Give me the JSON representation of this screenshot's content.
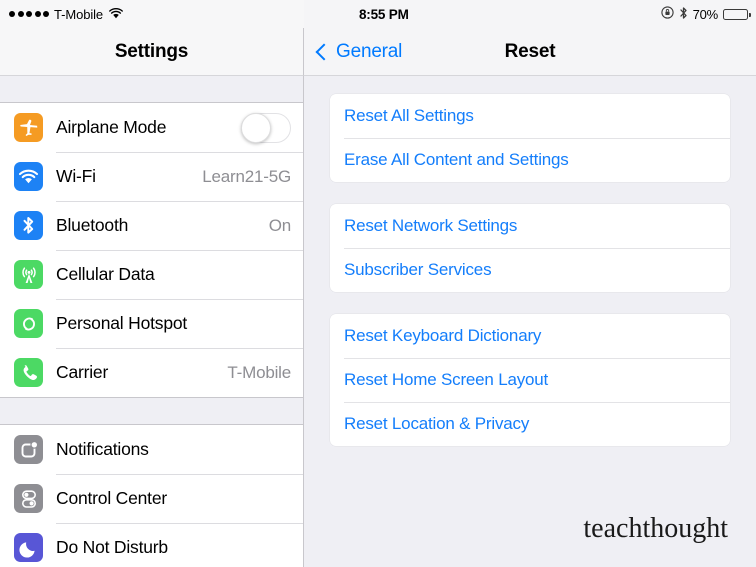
{
  "status_bar": {
    "signal_dots": 5,
    "carrier": "T-Mobile",
    "wifi_icon": "wifi-icon",
    "time": "8:55 PM",
    "rotation_lock_icon": "rotation-lock-icon",
    "bluetooth_icon": "bluetooth-icon",
    "battery_percent": "70%",
    "battery_level": 70
  },
  "sidebar": {
    "title": "Settings",
    "groups": [
      {
        "items": [
          {
            "label": "Airplane Mode",
            "icon": "airplane-icon",
            "icon_color": "#f59b23",
            "control": "toggle",
            "toggle_on": false
          },
          {
            "label": "Wi-Fi",
            "icon": "wifi-icon",
            "icon_color": "#1d82f5",
            "value": "Learn21-5G"
          },
          {
            "label": "Bluetooth",
            "icon": "bluetooth-icon",
            "icon_color": "#1d82f5",
            "value": "On"
          },
          {
            "label": "Cellular Data",
            "icon": "cellular-tower-icon",
            "icon_color": "#4cd964"
          },
          {
            "label": "Personal Hotspot",
            "icon": "hotspot-link-icon",
            "icon_color": "#4cd964"
          },
          {
            "label": "Carrier",
            "icon": "phone-icon",
            "icon_color": "#4cd964",
            "value": "T-Mobile"
          }
        ]
      },
      {
        "items": [
          {
            "label": "Notifications",
            "icon": "notifications-icon",
            "icon_color": "#8e8e93"
          },
          {
            "label": "Control Center",
            "icon": "control-center-icon",
            "icon_color": "#8e8e93"
          },
          {
            "label": "Do Not Disturb",
            "icon": "moon-icon",
            "icon_color": "#5856d6"
          }
        ]
      }
    ]
  },
  "detail": {
    "back_label": "General",
    "title": "Reset",
    "groups": [
      {
        "items": [
          {
            "label": "Reset All Settings"
          },
          {
            "label": "Erase All Content and Settings"
          }
        ]
      },
      {
        "items": [
          {
            "label": "Reset Network Settings"
          },
          {
            "label": "Subscriber Services"
          }
        ]
      },
      {
        "items": [
          {
            "label": "Reset Keyboard Dictionary"
          },
          {
            "label": "Reset Home Screen Layout"
          },
          {
            "label": "Reset Location & Privacy"
          }
        ]
      }
    ],
    "watermark": "teachthought"
  },
  "colors": {
    "accent_blue": "#147efb",
    "nav_blue": "#007aff",
    "panel_bg": "#efeff4",
    "row_bg": "#ffffff",
    "value_gray": "#8e8e93"
  }
}
